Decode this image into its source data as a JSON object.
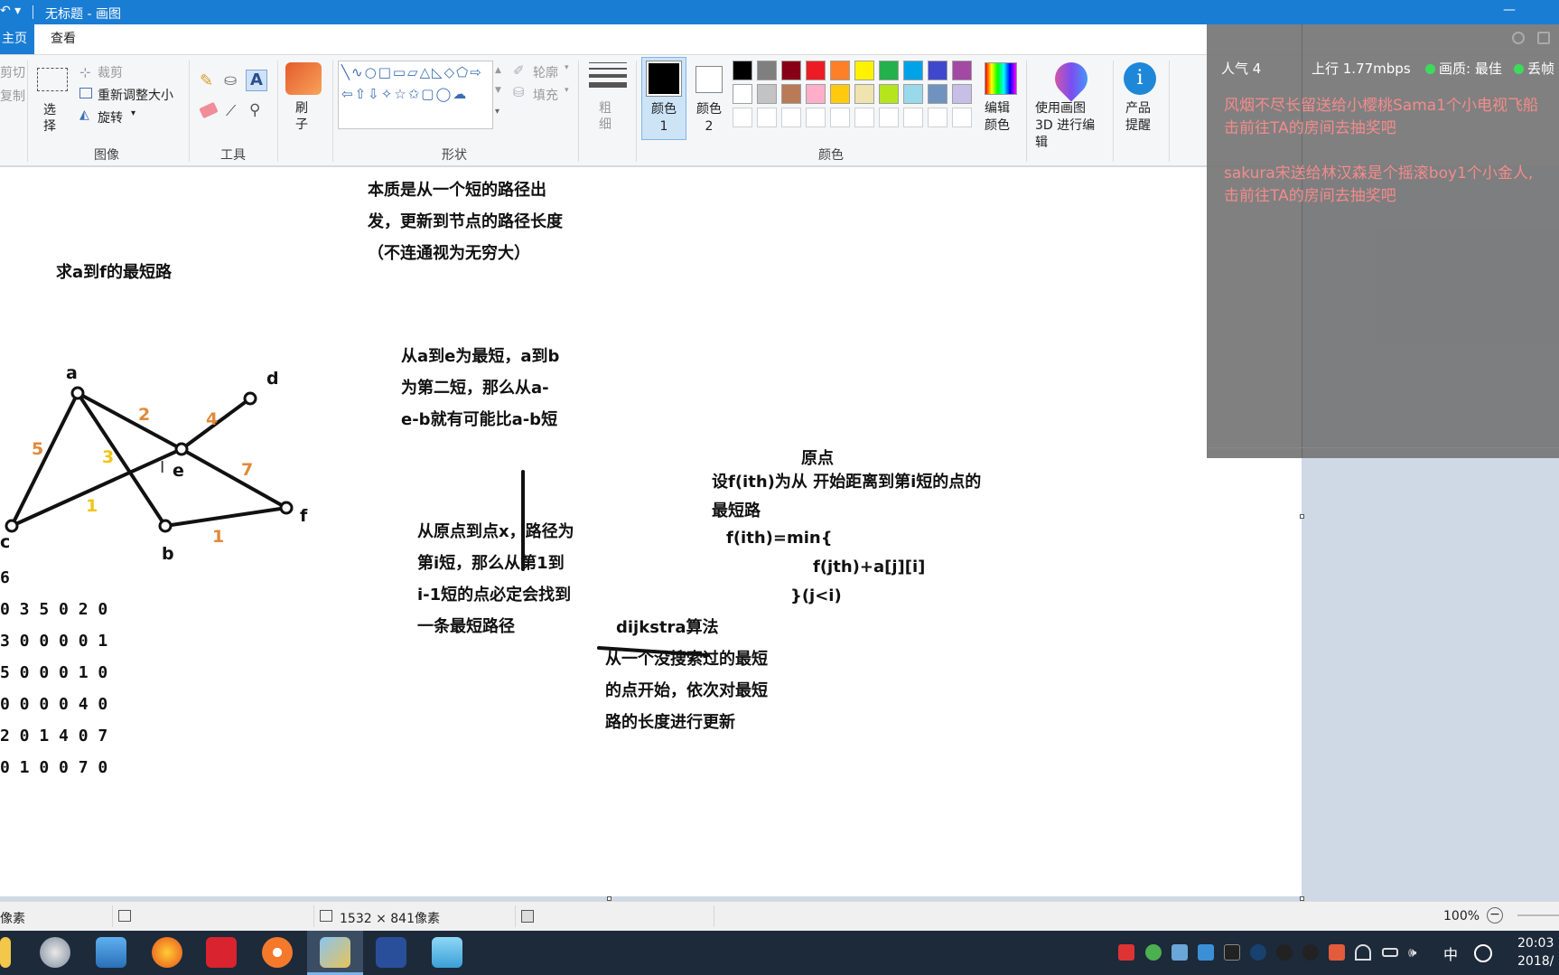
{
  "window": {
    "title": "无标题 - 画图",
    "minimize_glyph": "—"
  },
  "ribbon_tabs": {
    "home": "主页",
    "view": "查看"
  },
  "ribbon": {
    "clipboard": {
      "cut": "剪切",
      "copy": "复制"
    },
    "image": {
      "select": "选择",
      "crop": "裁剪",
      "resize": "重新调整大小",
      "rotate": "旋转",
      "group_label": "图像"
    },
    "tools": {
      "group_label": "工具"
    },
    "brush": {
      "label": "刷子"
    },
    "shapes": {
      "outline": "轮廓",
      "fill": "填充",
      "group_label": "形状"
    },
    "size": {
      "label": "粗细"
    },
    "color1": {
      "label": "颜色 1"
    },
    "color2": {
      "label": "颜色 2"
    },
    "colors": {
      "group_label": "颜色",
      "palette_row1": [
        "#000000",
        "#7f7f7f",
        "#880015",
        "#ed1c24",
        "#ff7f27",
        "#fff200",
        "#22b14c",
        "#00a2e8",
        "#3f48cc",
        "#a349a4"
      ],
      "palette_row2": [
        "#ffffff",
        "#c3c3c3",
        "#b97a57",
        "#ffaec9",
        "#ffc90e",
        "#efe4b0",
        "#b5e61d",
        "#99d9ea",
        "#7092be",
        "#c8bfe7"
      ],
      "palette_row3": [
        "#ffffff",
        "#ffffff",
        "#ffffff",
        "#ffffff",
        "#ffffff",
        "#ffffff",
        "#ffffff",
        "#ffffff",
        "#ffffff",
        "#ffffff"
      ]
    },
    "edit_colors": "编辑颜色",
    "paint3d": "使用画图 3D 进行编辑",
    "product_alert": "产品提醒"
  },
  "canvas": {
    "note_essence": [
      "本质是从一个短的路径出",
      "发，更新到节点的路径长度",
      "（不连通视为无穷大）"
    ],
    "note_problem": "求a到f的最短路",
    "note_shortest": [
      "从a到e为最短，a到b",
      "为第二短，那么从a-",
      "e-b就有可能比a-b短"
    ],
    "note_ith": [
      "从原点到点x，路径为",
      "第i短，那么从第1到",
      "i-1短的点必定会找到",
      "一条最短路径"
    ],
    "note_origin": "原点",
    "note_formula": [
      "设f(ith)为从  开始距离到第i短的点的",
      "最短路",
      "f(ith)=min{",
      "f(jth)+a[j][i]",
      "}(j<i)"
    ],
    "note_dijkstra": [
      "dijkstra算法",
      "从一个没搜索过的最短",
      "的点开始，依次对最短",
      "路的长度进行更新"
    ],
    "matrix": [
      "6",
      "0 3 5 0 2 0",
      "3 0 0 0 0 1",
      "5 0 0 0 1 0",
      "0 0 0 0 4 0",
      "2 0 1 4 0 7",
      "0 1 0 0 7 0"
    ],
    "graph": {
      "node_labels": [
        "a",
        "b",
        "c",
        "d",
        "e",
        "f"
      ],
      "edge_weights": [
        "5",
        "2",
        "3",
        "4",
        "1",
        "7",
        "1"
      ]
    }
  },
  "overlay": {
    "popularity": "人气 4",
    "upload": "上行 1.77mbps",
    "quality": "画质: 最佳",
    "drop": "丢帧",
    "messages": [
      "风烟不尽长留送给小樱桃Sama1个小电视飞船",
      "击前往TA的房间去抽奖吧",
      "sakura宋送给林汉森是个摇滚boy1个小金人,",
      "击前往TA的房间去抽奖吧"
    ]
  },
  "statusbar": {
    "pixels": "像素",
    "dimensions": "1532 × 841像素",
    "zoom": "100%"
  },
  "taskbar": {
    "ime": "中",
    "time": "20:03",
    "date": "2018/"
  }
}
